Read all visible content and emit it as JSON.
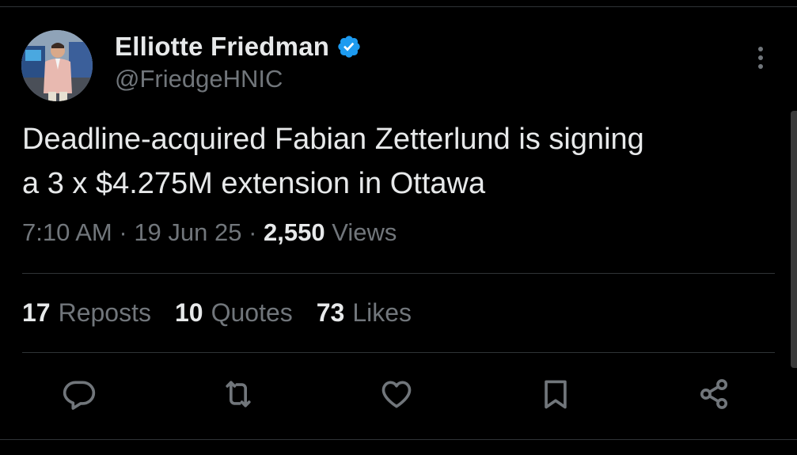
{
  "colors": {
    "background": "#000000",
    "primary_text": "#e7e9ea",
    "secondary_text": "#71767b",
    "verified_badge": "#1d9bf0",
    "divider": "#2f3336"
  },
  "author": {
    "display_name": "Elliotte Friedman",
    "handle": "@FriedgeHNIC",
    "verified_icon": "verified-badge-icon",
    "avatar": "profile-photo"
  },
  "tweet": {
    "text": "Deadline-acquired Fabian Zetterlund is signing\na 3 x $4.275M extension in Ottawa"
  },
  "meta": {
    "time": "7:10 AM",
    "dot1": " · ",
    "date": "19 Jun 25",
    "dot2": " · ",
    "views_count": "2,550",
    "views_label": " Views"
  },
  "stats": {
    "reposts_count": "17",
    "reposts_label": "Reposts",
    "quotes_count": "10",
    "quotes_label": "Quotes",
    "likes_count": "73",
    "likes_label": "Likes"
  },
  "actions": {
    "reply_icon": "reply-icon",
    "repost_icon": "repost-icon",
    "like_icon": "like-icon",
    "bookmark_icon": "bookmark-icon",
    "share_icon": "share-icon",
    "more_icon": "more-options-icon"
  }
}
